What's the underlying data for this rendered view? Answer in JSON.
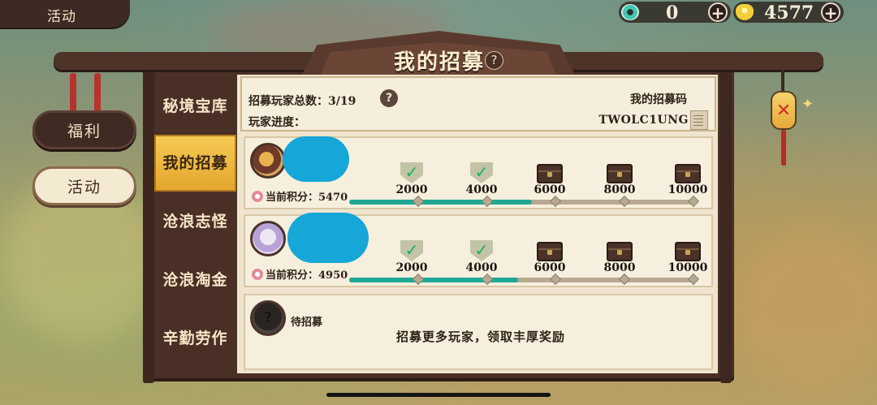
{
  "top_tab": {
    "label": "活动"
  },
  "currency": [
    {
      "icon": "jade-coin-icon",
      "value": "0"
    },
    {
      "icon": "gold-ingot-icon",
      "value": "4577"
    }
  ],
  "title": "我的招募",
  "help_glyph": "?",
  "side_menu": [
    {
      "label": "福利",
      "active": false
    },
    {
      "label": "活动",
      "active": true
    }
  ],
  "tabs": [
    {
      "label": "秘境宝库",
      "active": false
    },
    {
      "label": "我的招募",
      "active": true
    },
    {
      "label": "沧浪志怪",
      "active": false
    },
    {
      "label": "沧浪淘金",
      "active": false
    },
    {
      "label": "辛勤劳作",
      "active": false
    }
  ],
  "header": {
    "total_label": "招募玩家总数：3/19",
    "progress_label": "玩家进度：",
    "code_label": "我的招募码",
    "code_value": "TWOLC1UNG"
  },
  "players": [
    {
      "score_label": "当前积分：5470",
      "score": 5470,
      "progress": 0.53,
      "milestones": [
        {
          "value": "2000",
          "claimed": true
        },
        {
          "value": "4000",
          "claimed": true
        },
        {
          "value": "6000",
          "claimed": false
        },
        {
          "value": "8000",
          "claimed": false
        },
        {
          "value": "10000",
          "claimed": false
        }
      ]
    },
    {
      "score_label": "当前积分：4950",
      "score": 4950,
      "progress": 0.49,
      "milestones": [
        {
          "value": "2000",
          "claimed": true
        },
        {
          "value": "4000",
          "claimed": true
        },
        {
          "value": "6000",
          "claimed": false
        },
        {
          "value": "8000",
          "claimed": false
        },
        {
          "value": "10000",
          "claimed": false
        }
      ]
    }
  ],
  "pending": {
    "label": "待招募",
    "message": "招募更多玩家，领取丰厚奖励",
    "avatar_glyph": "?"
  },
  "colors": {
    "frame": "#4a2f26",
    "active_tab": "#f4cb55",
    "progress_fill": "#1fa894",
    "name_mask": "#16a6d8"
  }
}
